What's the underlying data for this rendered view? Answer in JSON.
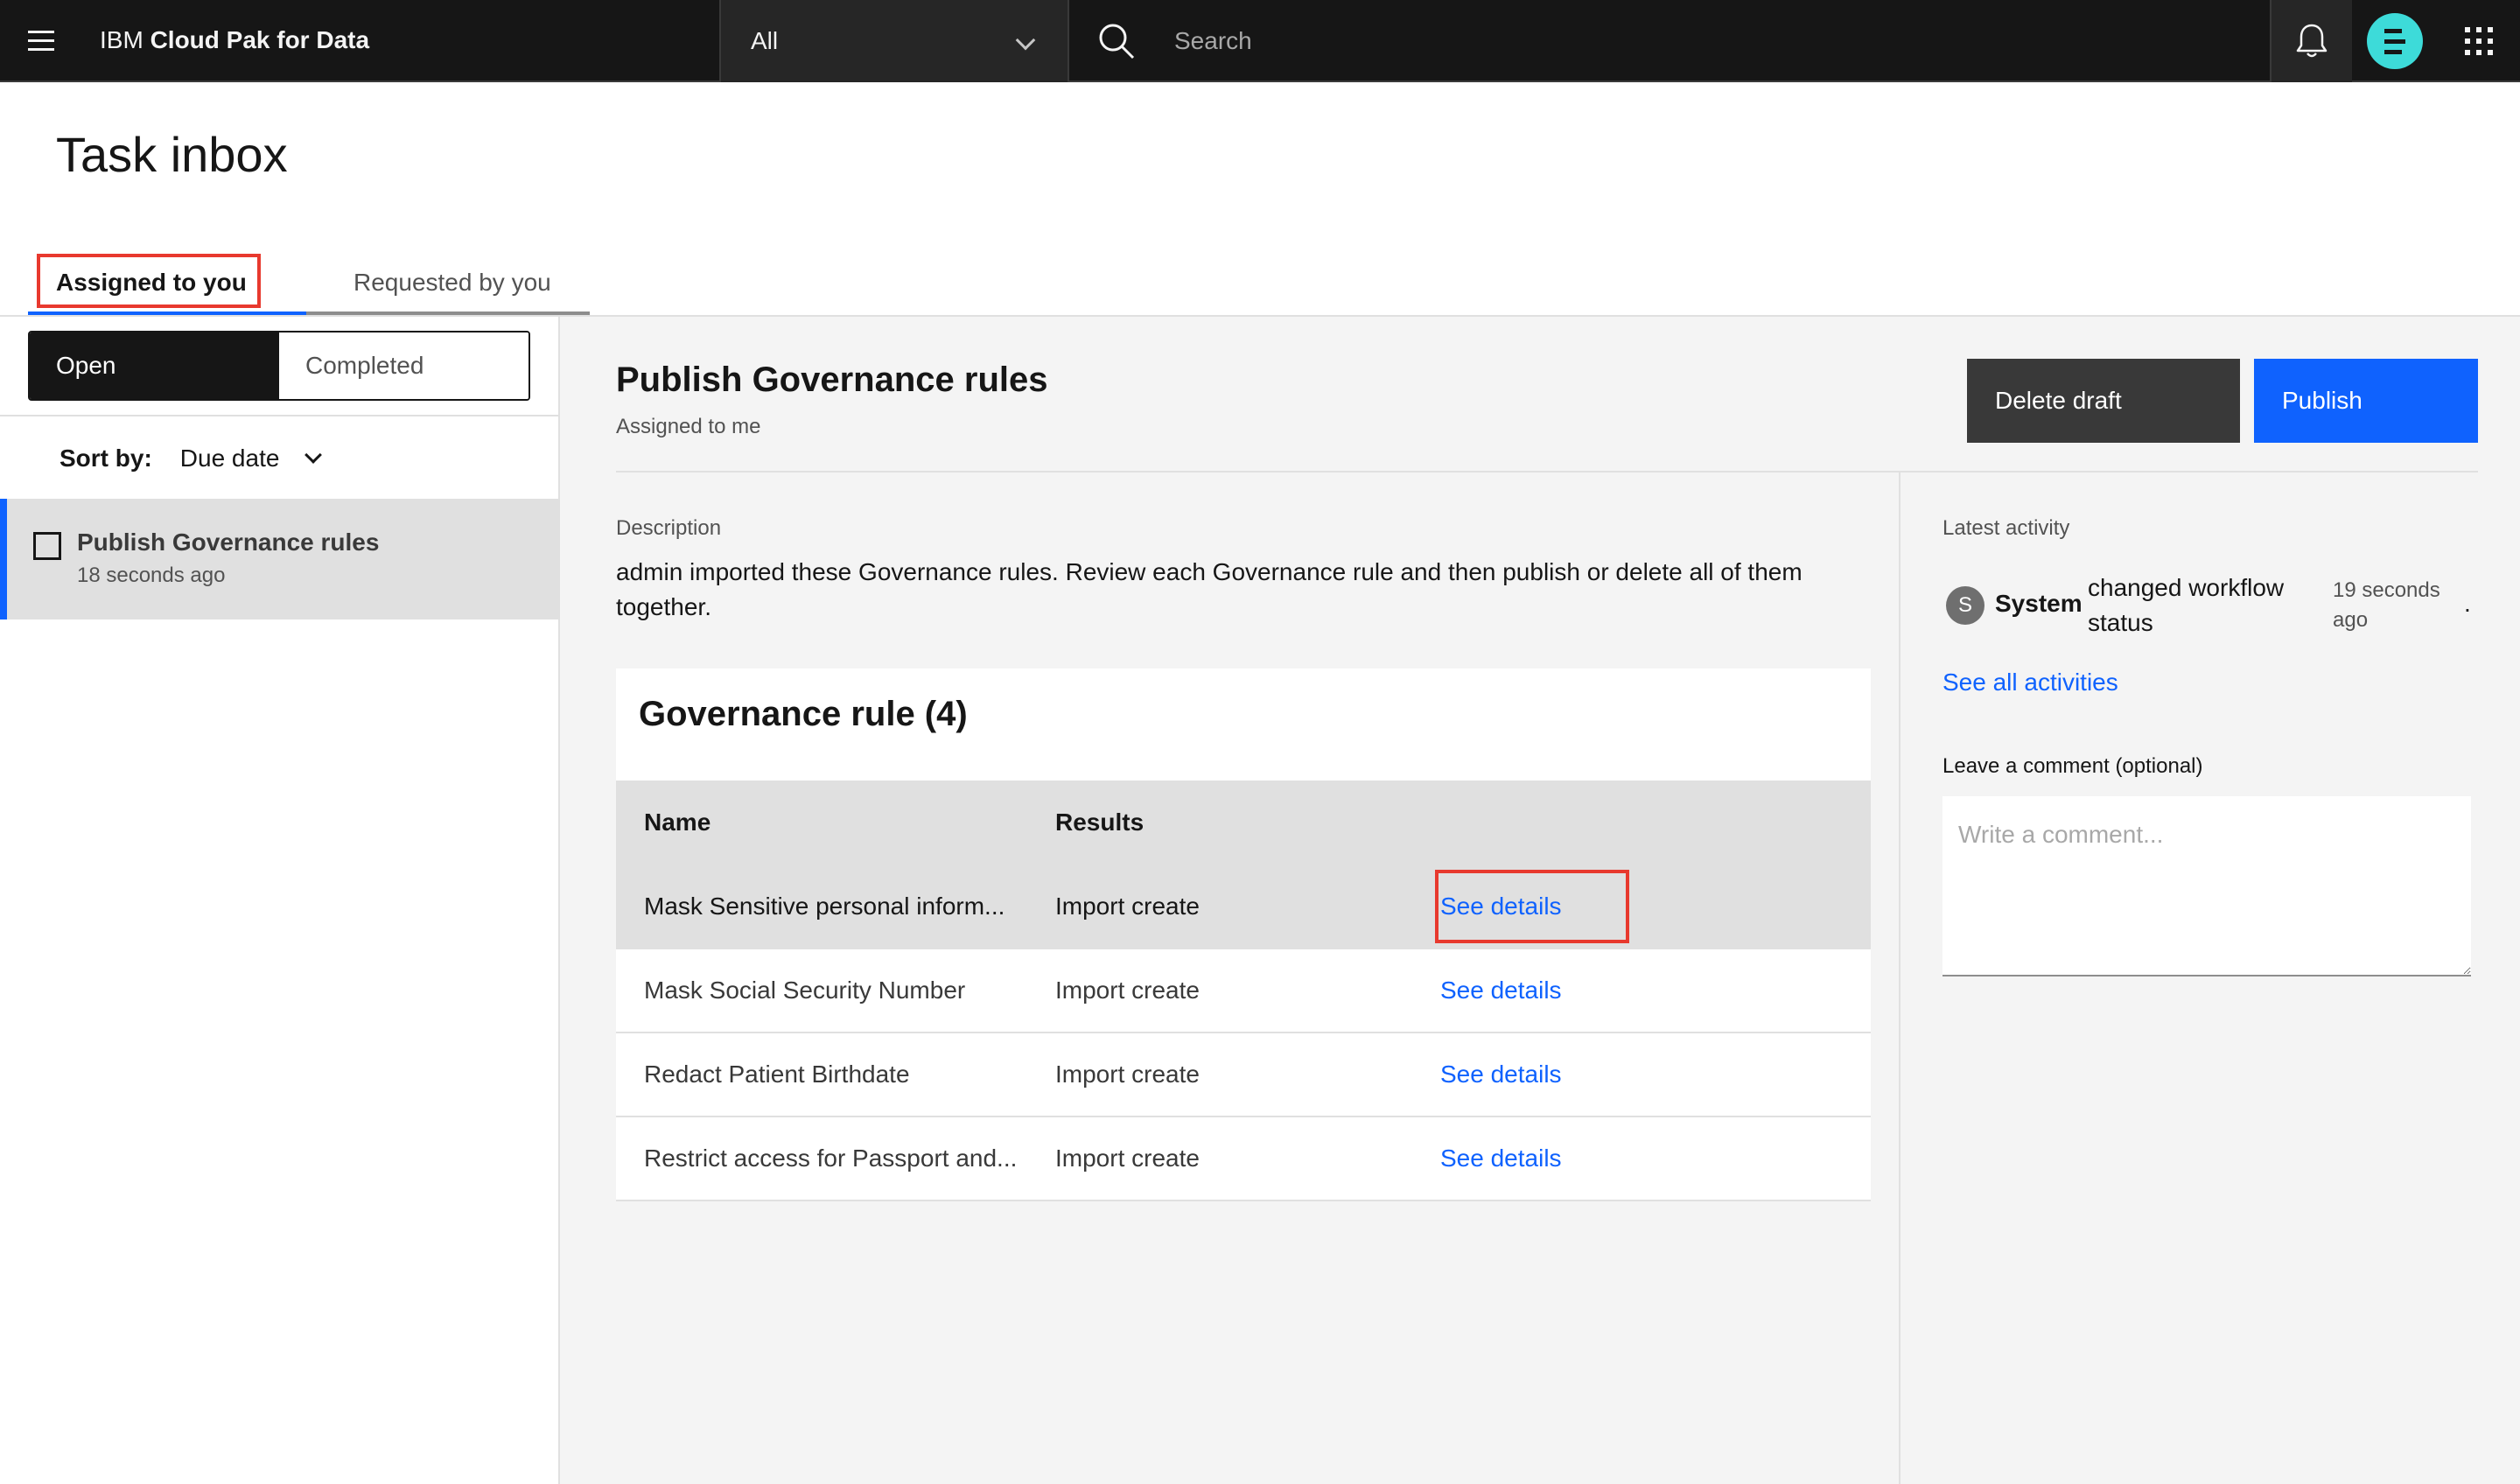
{
  "header": {
    "brand_prefix": "IBM",
    "brand_product": "Cloud Pak for Data",
    "scope_value": "All",
    "search_placeholder": "Search"
  },
  "page": {
    "title": "Task inbox",
    "tabs": [
      {
        "label": "Assigned to you",
        "active": true
      },
      {
        "label": "Requested by you",
        "active": false
      }
    ]
  },
  "left_panel": {
    "switcher": [
      {
        "label": "Open",
        "selected": true
      },
      {
        "label": "Completed",
        "selected": false
      }
    ],
    "sort_label": "Sort by:",
    "sort_value": "Due date",
    "tasks": [
      {
        "title": "Publish Governance rules",
        "time": "18 seconds ago",
        "checked": false
      }
    ]
  },
  "task": {
    "title": "Publish Governance rules",
    "subtitle": "Assigned to me",
    "delete_label": "Delete draft",
    "publish_label": "Publish",
    "description_label": "Description",
    "description": "admin imported these Governance rules. Review each Governance rule and then publish or delete all of them together.",
    "rules_title": "Governance rule (4)",
    "columns": [
      "Name",
      "Results"
    ],
    "rules": [
      {
        "name": "Mask Sensitive personal inform...",
        "result": "Import create",
        "link": "See details"
      },
      {
        "name": "Mask Social Security Number",
        "result": "Import create",
        "link": "See details"
      },
      {
        "name": "Redact Patient Birthdate",
        "result": "Import create",
        "link": "See details"
      },
      {
        "name": "Restrict access for Passport and...",
        "result": "Import create",
        "link": "See details"
      }
    ]
  },
  "activity": {
    "label": "Latest activity",
    "badge": "S",
    "actor": "System",
    "action": "changed workflow status",
    "time": "19 seconds ago",
    "trailing": ".",
    "see_all": "See all activities",
    "comment_label": "Leave a comment (optional)",
    "comment_placeholder": "Write a comment..."
  },
  "colors": {
    "header_bg": "#161616",
    "accent": "#0f62fe",
    "highlight": "#e8392e",
    "avatar": "#3ddbd9"
  },
  "icons": [
    "menu-icon",
    "chevron-down-icon",
    "search-icon",
    "notification-bell-icon",
    "user-avatar-icon",
    "app-switcher-icon",
    "checkbox-icon"
  ]
}
